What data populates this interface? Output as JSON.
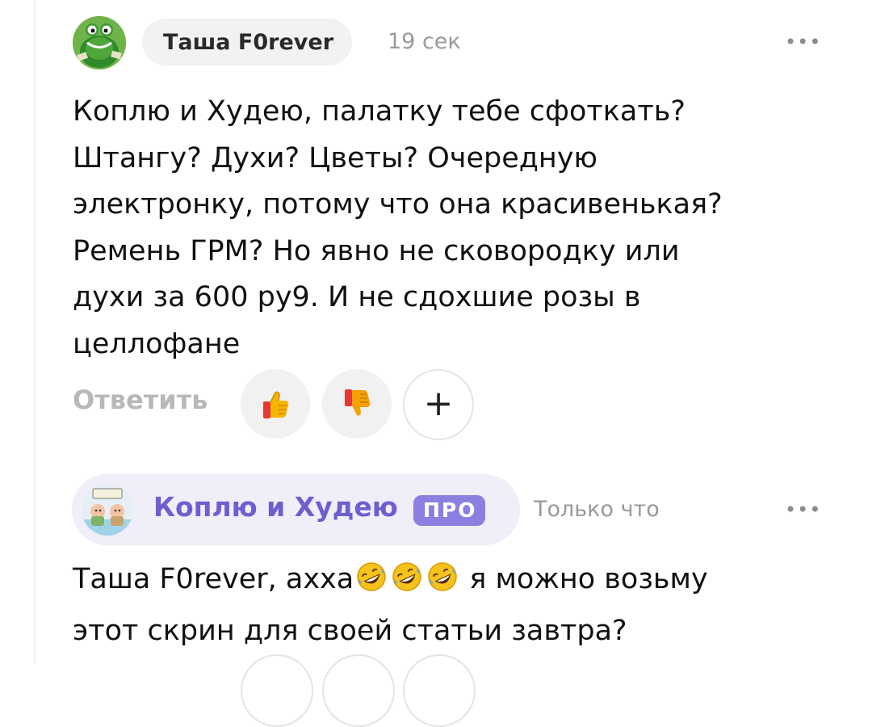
{
  "comments": [
    {
      "author": "Таша F0rever",
      "time": "19 сек",
      "more": "•••",
      "text": "Коплю и Худею, палатку тебе сфоткать?\nШтангу? Духи? Цветы? Очередную\nэлектронку, потому что она красивенькая?\nРемень ГРМ? Но явно не сковородку или\nдухи за 600 ру9. И не сдохшие розы в\nцеллофане",
      "actions": {
        "reply_label": "Ответить",
        "like_icon": "thumbs-up-icon",
        "dislike_icon": "thumbs-down-icon",
        "add_icon": "plus-icon",
        "add_glyph": "+"
      }
    },
    {
      "author": "Коплю и Худею",
      "badge": "ПРО",
      "time": "Только что",
      "more": "•••",
      "text_before": "Таша F0rever, ахха",
      "emoji_icon": "rofl-emoji-icon",
      "text_after": " я можно возьму\nэтот скрин для своей статьи завтра?"
    }
  ],
  "colors": {
    "brand_purple": "#6d5fd2",
    "badge_purple": "#8b80e2",
    "author_pill_bg": "#f0eef9",
    "muted_text": "#9a9a9a"
  }
}
